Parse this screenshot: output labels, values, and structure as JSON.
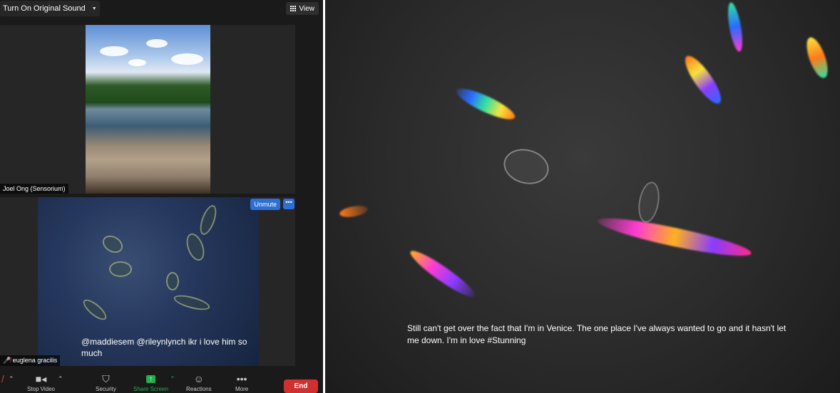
{
  "top_bar": {
    "sound_label": "Turn On Original Sound",
    "view_label": "View"
  },
  "participants": [
    {
      "name": "Joel Ong (Sensorium)"
    },
    {
      "name": "euglena gracilis",
      "unmute_label": "Unmute",
      "more_label": "•••"
    }
  ],
  "left_caption": "@maddiesem @rileynlynch ikr i love him so much",
  "right_caption": "Still can't get over the fact that I'm in Venice. The one place I've always wanted to go and it hasn't let me down. I'm in love #Stunning",
  "toolbar": {
    "stop_video": "Stop Video",
    "security": "Security",
    "share_screen": "Share Screen",
    "reactions": "Reactions",
    "more": "More",
    "end": "End"
  },
  "colors": {
    "accent": "#2d6fd6",
    "end": "#d03030",
    "share": "#22b14c"
  }
}
